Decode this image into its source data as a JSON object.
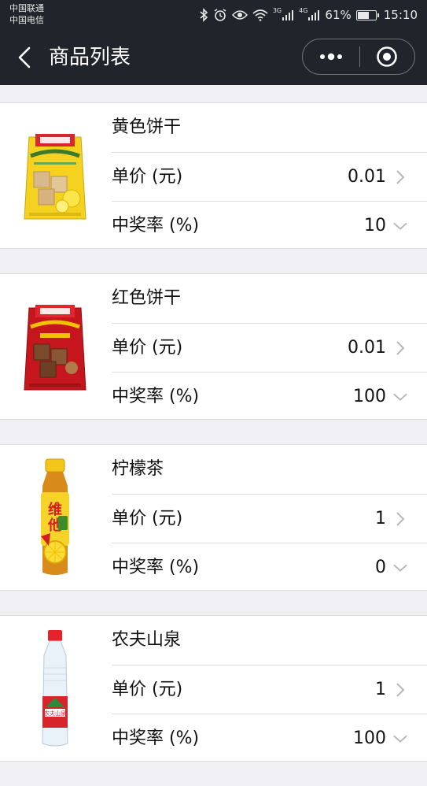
{
  "status_bar": {
    "carrier_1": "中国联通",
    "carrier_2": "中国电信",
    "network_1": "3G",
    "network_2": "4G",
    "battery": "61%",
    "time": "15:10"
  },
  "nav": {
    "title": "商品列表"
  },
  "products": [
    {
      "name": "黄色饼干",
      "price_label": "单价 (元)",
      "price": "0.01",
      "rate_label": "中奖率 (%)",
      "rate": "10",
      "image": "loacker-quadratini-lemon"
    },
    {
      "name": "红色饼干",
      "price_label": "单价 (元)",
      "price": "0.01",
      "rate_label": "中奖率 (%)",
      "rate": "100",
      "image": "loacker-quadratini-hazelnut"
    },
    {
      "name": "柠檬茶",
      "price_label": "单价 (元)",
      "price": "1",
      "rate_label": "中奖率 (%)",
      "rate": "0",
      "image": "vita-lemon-tea-bottle"
    },
    {
      "name": "农夫山泉",
      "price_label": "单价 (元)",
      "price": "1",
      "rate_label": "中奖率 (%)",
      "rate": "100",
      "image": "nongfu-spring-water-bottle"
    }
  ]
}
